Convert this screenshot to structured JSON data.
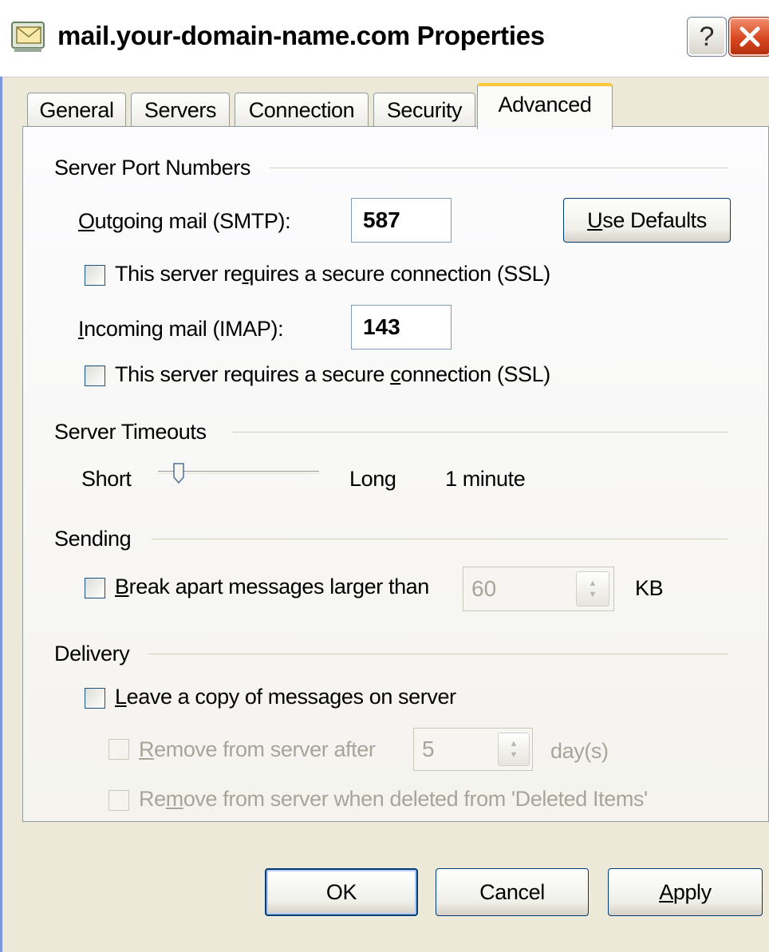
{
  "window": {
    "title": "mail.your-domain-name.com Properties",
    "icons": {
      "app": "mail-server-icon",
      "help": "help-icon",
      "close": "close-icon"
    },
    "help_label": "?"
  },
  "tabs": [
    {
      "label": "General",
      "active": false
    },
    {
      "label": "Servers",
      "active": false
    },
    {
      "label": "Connection",
      "active": false
    },
    {
      "label": "Security",
      "active": false
    },
    {
      "label": "Advanced",
      "active": true
    }
  ],
  "ports": {
    "group_label": "Server Port Numbers",
    "outgoing": {
      "label_first": "O",
      "label_rest": "utgoing mail (SMTP):",
      "value": "587"
    },
    "use_defaults": {
      "first": "U",
      "rest": "se Defaults"
    },
    "ssl_outgoing": {
      "before": "This server re",
      "key": "q",
      "after": "uires a secure connection (SSL)",
      "checked": false
    },
    "incoming": {
      "label_first": "I",
      "label_rest": "ncoming mail (IMAP):",
      "value": "143"
    },
    "ssl_incoming": {
      "before": "This server requires a secure ",
      "key": "c",
      "after": "onnection (SSL)",
      "checked": false
    }
  },
  "timeouts": {
    "group_label": "Server Timeouts",
    "short_label": "Short",
    "long_label": "Long",
    "value_text": "1 minute",
    "slider_fraction": 0.1
  },
  "sending": {
    "group_label": "Sending",
    "break_apart": {
      "first": "B",
      "rest": "reak apart messages larger than",
      "checked": false
    },
    "size_value": "60",
    "unit": "KB"
  },
  "delivery": {
    "group_label": "Delivery",
    "leave_copy": {
      "first": "L",
      "rest": "eave a copy of messages on server",
      "checked": false
    },
    "remove_after": {
      "first": "R",
      "rest": "emove from server after",
      "value": "5",
      "unit": "day(s)",
      "enabled": false
    },
    "remove_deleted": {
      "before": "Re",
      "key": "m",
      "after": "ove from server when deleted from 'Deleted Items'",
      "enabled": false
    }
  },
  "footer": {
    "ok": "OK",
    "cancel": "Cancel",
    "apply": {
      "first": "A",
      "rest": "pply"
    }
  }
}
